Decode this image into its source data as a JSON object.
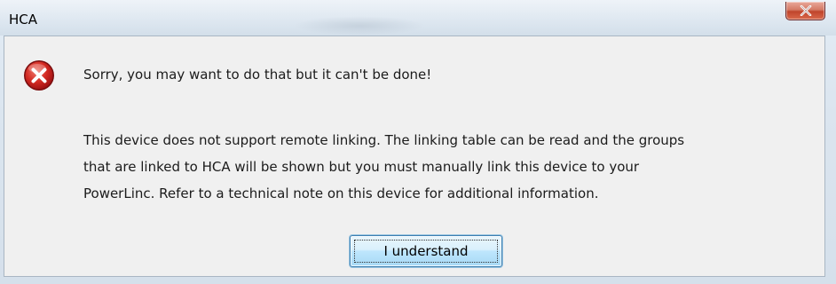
{
  "window": {
    "title": "HCA"
  },
  "dialog": {
    "icon": "error-icon",
    "headline": "Sorry, you may want to do that but it can't be done!",
    "message_lines": [
      "This device does not support remote linking. The linking table can be read and the groups",
      "that are linked to HCA will be shown but you must manually link this device to your",
      "PowerLinc. Refer to a technical note on this device for additional information."
    ],
    "button_label": "I understand"
  },
  "colors": {
    "close_button": "#c0452c",
    "error_icon": "#c8191b",
    "button_border": "#3c7fb1"
  }
}
